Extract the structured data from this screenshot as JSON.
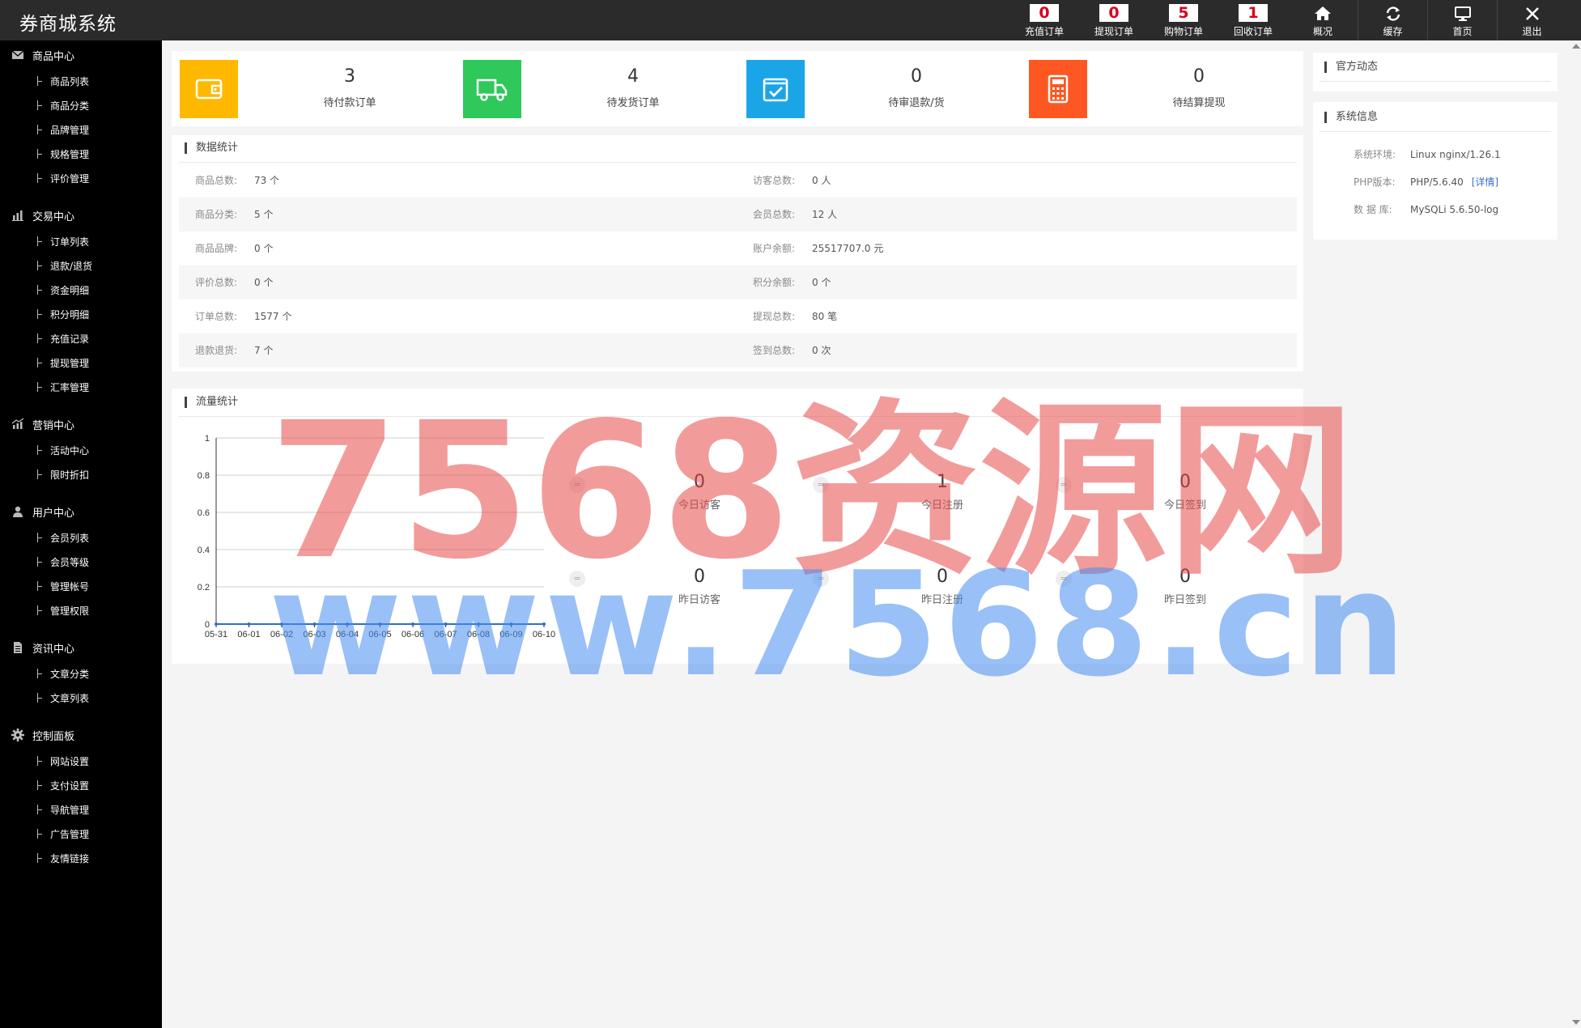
{
  "header": {
    "title": "券商城系统",
    "nav": [
      {
        "label": "充值订单",
        "count": "0"
      },
      {
        "label": "提现订单",
        "count": "0"
      },
      {
        "label": "购物订单",
        "count": "5"
      },
      {
        "label": "回收订单",
        "count": "1"
      },
      {
        "label": "概况",
        "icon": "home-icon"
      },
      {
        "label": "缓存",
        "icon": "refresh-icon"
      },
      {
        "label": "首页",
        "icon": "monitor-icon"
      },
      {
        "label": "退出",
        "icon": "close-icon"
      }
    ]
  },
  "sidebar": {
    "groups": [
      {
        "label": "商品中心",
        "icon": "mail-icon",
        "items": [
          "商品列表",
          "商品分类",
          "品牌管理",
          "规格管理",
          "评价管理"
        ]
      },
      {
        "label": "交易中心",
        "icon": "bar-chart-icon",
        "items": [
          "订单列表",
          "退款/退货",
          "资金明细",
          "积分明细",
          "充值记录",
          "提现管理",
          "汇率管理"
        ]
      },
      {
        "label": "营销中心",
        "icon": "growth-chart-icon",
        "items": [
          "活动中心",
          "限时折扣"
        ]
      },
      {
        "label": "用户中心",
        "icon": "user-icon",
        "items": [
          "会员列表",
          "会员等级",
          "管理帐号",
          "管理权限"
        ]
      },
      {
        "label": "资讯中心",
        "icon": "document-icon",
        "items": [
          "文章分类",
          "文章列表"
        ]
      },
      {
        "label": "控制面板",
        "icon": "gear-icon",
        "items": [
          "网站设置",
          "支付设置",
          "导航管理",
          "广告管理",
          "友情链接"
        ]
      }
    ]
  },
  "stats": [
    {
      "value": "3",
      "label": "待付款订单",
      "color": "#ffb800",
      "icon": "wallet-icon"
    },
    {
      "value": "4",
      "label": "待发货订单",
      "color": "#2fc85a",
      "icon": "truck-icon"
    },
    {
      "value": "0",
      "label": "待审退款/货",
      "color": "#1aa6e6",
      "icon": "checkbox-icon"
    },
    {
      "value": "0",
      "label": "待结算提现",
      "color": "#ff5722",
      "icon": "calculator-icon"
    }
  ],
  "data_stats": {
    "title": "数据统计",
    "rows": [
      {
        "l_label": "商品总数:",
        "l_value": "73 个",
        "r_label": "访客总数:",
        "r_value": "0 人"
      },
      {
        "l_label": "商品分类:",
        "l_value": "5 个",
        "r_label": "会员总数:",
        "r_value": "12 人"
      },
      {
        "l_label": "商品品牌:",
        "l_value": "0 个",
        "r_label": "账户余额:",
        "r_value": "25517707.0 元"
      },
      {
        "l_label": "评价总数:",
        "l_value": "0 个",
        "r_label": "积分余额:",
        "r_value": "0 个"
      },
      {
        "l_label": "订单总数:",
        "l_value": "1577 个",
        "r_label": "提现总数:",
        "r_value": "80 笔"
      },
      {
        "l_label": "退款退货:",
        "l_value": "7 个",
        "r_label": "签到总数:",
        "r_value": "0 次"
      }
    ]
  },
  "traffic": {
    "title": "流量统计",
    "stats": [
      {
        "value": "0",
        "label": "今日访客"
      },
      {
        "value": "1",
        "label": "今日注册"
      },
      {
        "value": "0",
        "label": "今日签到"
      },
      {
        "value": "0",
        "label": "昨日访客"
      },
      {
        "value": "0",
        "label": "昨日注册"
      },
      {
        "value": "0",
        "label": "昨日签到"
      }
    ],
    "eq_symbol": "="
  },
  "chart_data": {
    "type": "line",
    "categories": [
      "05-31",
      "06-01",
      "06-02",
      "06-03",
      "06-04",
      "06-05",
      "06-06",
      "06-07",
      "06-08",
      "06-09",
      "06-10"
    ],
    "values": [
      0,
      0,
      0,
      0,
      0,
      0,
      0,
      0,
      0,
      0,
      0
    ],
    "yticks": [
      "0",
      "0.2",
      "0.4",
      "0.6",
      "0.8",
      "1"
    ],
    "ylim": [
      0,
      1
    ],
    "grid": true,
    "series_color": "#2f6fca"
  },
  "news": {
    "title": "官方动态"
  },
  "sysinfo": {
    "title": "系统信息",
    "rows": [
      {
        "label": "系统环境:",
        "value": "Linux nginx/1.26.1"
      },
      {
        "label": "PHP版本:",
        "value": "PHP/5.6.40",
        "link": "[详情]"
      },
      {
        "label": "数 据 库:",
        "value": "MySQLi 5.6.50-log"
      }
    ]
  },
  "watermark": {
    "line1": "7568资源网",
    "line2": "www.7568.cn"
  }
}
